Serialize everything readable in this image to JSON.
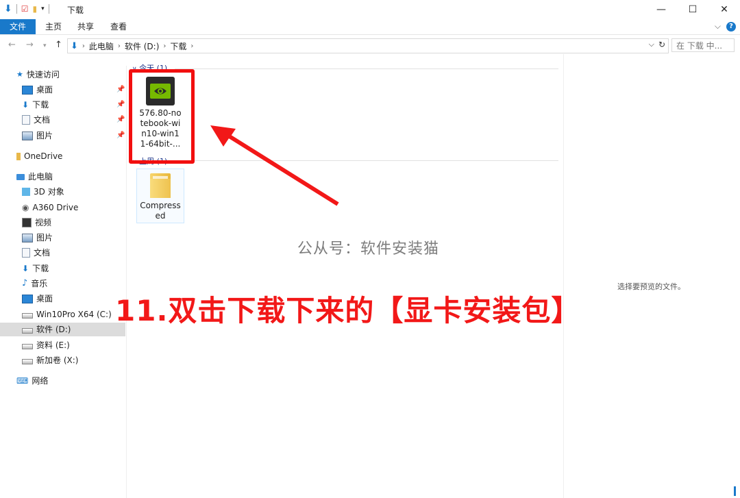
{
  "window": {
    "title": "下载"
  },
  "ribbon": {
    "tabs": [
      "文件",
      "主页",
      "共享",
      "查看"
    ]
  },
  "address": {
    "crumbs": [
      "此电脑",
      "软件 (D:)",
      "下载"
    ],
    "search_placeholder": "在 下载 中..."
  },
  "nav": {
    "quick_access": "快速访问",
    "quick_items": [
      "桌面",
      "下载",
      "文档",
      "图片"
    ],
    "onedrive": "OneDrive",
    "this_pc": "此电脑",
    "pc_items": [
      "3D 对象",
      "A360 Drive",
      "视频",
      "图片",
      "文档",
      "下载",
      "音乐",
      "桌面",
      "Win10Pro X64 (C:)",
      "软件 (D:)",
      "资料 (E:)",
      "新加卷 (X:)"
    ],
    "network": "网络"
  },
  "groups": [
    {
      "header": "今天 (1)",
      "items": [
        {
          "name": "576.80-notebook-win10-win11-64bit-..."
        }
      ]
    },
    {
      "header": "上周 (1)",
      "items": [
        {
          "name": "Compressed"
        }
      ]
    }
  ],
  "file1_lines": [
    "576.80-no",
    "tebook-wi",
    "n10-win1",
    "1-64bit-..."
  ],
  "file2_lines": [
    "Compress",
    "ed"
  ],
  "preview": {
    "empty_text": "选择要预览的文件。"
  },
  "watermark": "公从号：软件安装猫",
  "instruction": "11.双击下载下来的【显卡安装包】",
  "colors": {
    "accent": "#1979ca",
    "highlight_red": "#f20f0f",
    "nvidia_green": "#76b900"
  }
}
